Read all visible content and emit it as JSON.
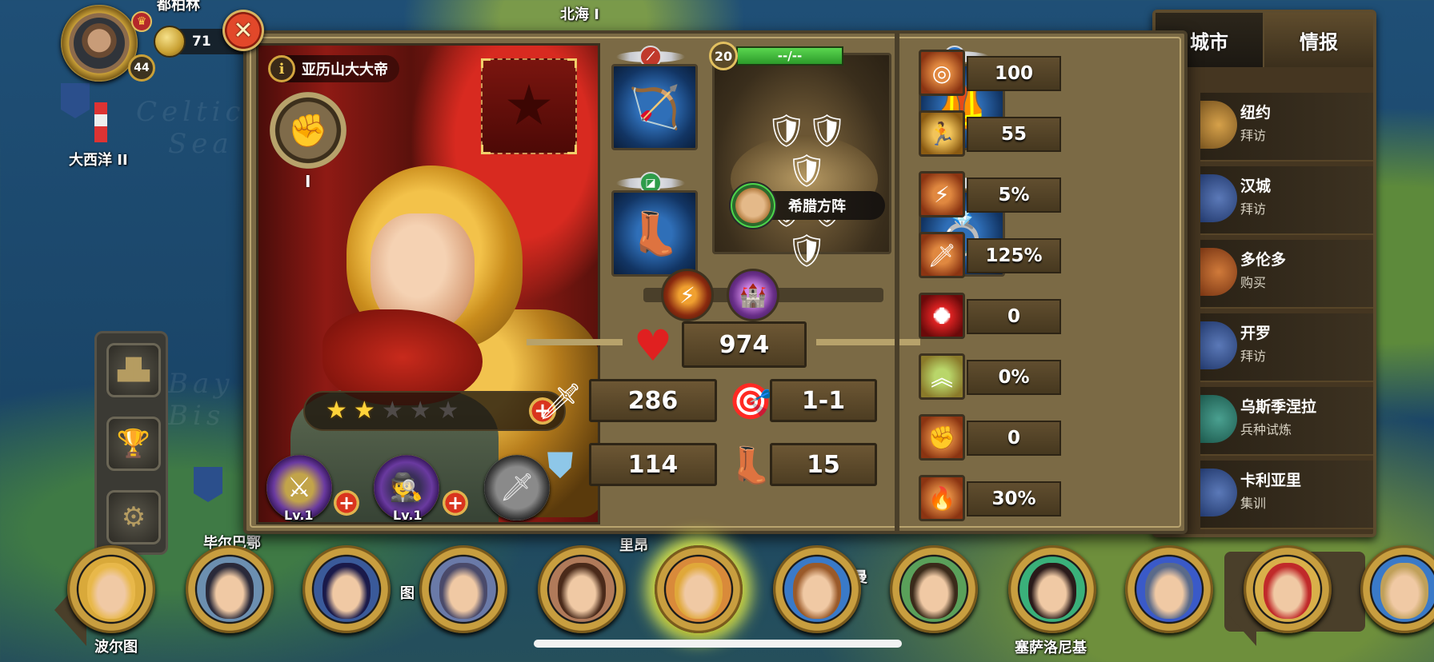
{
  "map": {
    "labels": [
      "都柏林",
      "北海 I",
      "大西洋 II",
      "波尔图",
      "塞萨洛尼基",
      "毕尔巴鄂",
      "里昂",
      "图",
      "曼"
    ],
    "watermarks": [
      "Celtic",
      "Sea",
      "Bay",
      "Bis"
    ]
  },
  "player": {
    "level": "44",
    "gold": "71"
  },
  "hero": {
    "name": "亚历山大大帝",
    "bond_label": "I",
    "stars_filled": 2,
    "stars_total": 5,
    "skills": [
      {
        "icon": "phalanx-skill-icon",
        "level": "Lv.1"
      },
      {
        "icon": "spy-skill-icon",
        "level": "Lv.1"
      },
      {
        "icon": "sword-skill-icon",
        "level": ""
      }
    ]
  },
  "troop": {
    "level": "20",
    "hp_text": "--/--",
    "name": "希腊方阵"
  },
  "equipment": [
    {
      "slot": "weapon",
      "icon": "crossbow-icon",
      "badge": "weapon-badge-icon"
    },
    {
      "slot": "boots",
      "icon": "boots-icon",
      "badge": "boots-badge-icon"
    },
    {
      "slot": "armor",
      "icon": "armor-icon",
      "badge": "armor-badge-icon"
    },
    {
      "slot": "ring",
      "icon": "ring-icon",
      "badge": "ring-badge-icon"
    }
  ],
  "gems": [
    "fire-gem-icon",
    "tower-gem-icon"
  ],
  "stats": {
    "hp": "974",
    "attack": "286",
    "range": "1-1",
    "defense": "114",
    "move": "15"
  },
  "attributes": [
    {
      "icon": "target-icon",
      "value": "100"
    },
    {
      "icon": "dodge-icon",
      "value": "55"
    },
    {
      "icon": "crit-icon",
      "value": "5%"
    },
    {
      "icon": "crit-damage-icon",
      "value": "125%"
    },
    {
      "icon": "heal-icon",
      "value": "0"
    },
    {
      "icon": "rank-up-icon",
      "value": "0%"
    },
    {
      "icon": "fist-icon",
      "value": "0"
    },
    {
      "icon": "rage-icon",
      "value": "30%"
    }
  ],
  "city_panel": {
    "tabs": [
      "城市",
      "情报"
    ],
    "cities": [
      {
        "name": "纽约",
        "action": "拜访"
      },
      {
        "name": "汉城",
        "action": "拜访"
      },
      {
        "name": "多伦多",
        "action": "购买"
      },
      {
        "name": "开罗",
        "action": "拜访"
      },
      {
        "name": "乌斯季涅拉",
        "action": "兵种试炼"
      },
      {
        "name": "卡利亚里",
        "action": "集训"
      }
    ]
  },
  "colors": {
    "panel": "#7b6a45",
    "accent_gold": "#e2c060",
    "hp_green": "#4cc442",
    "selected_glow": "#e4ef4b"
  }
}
